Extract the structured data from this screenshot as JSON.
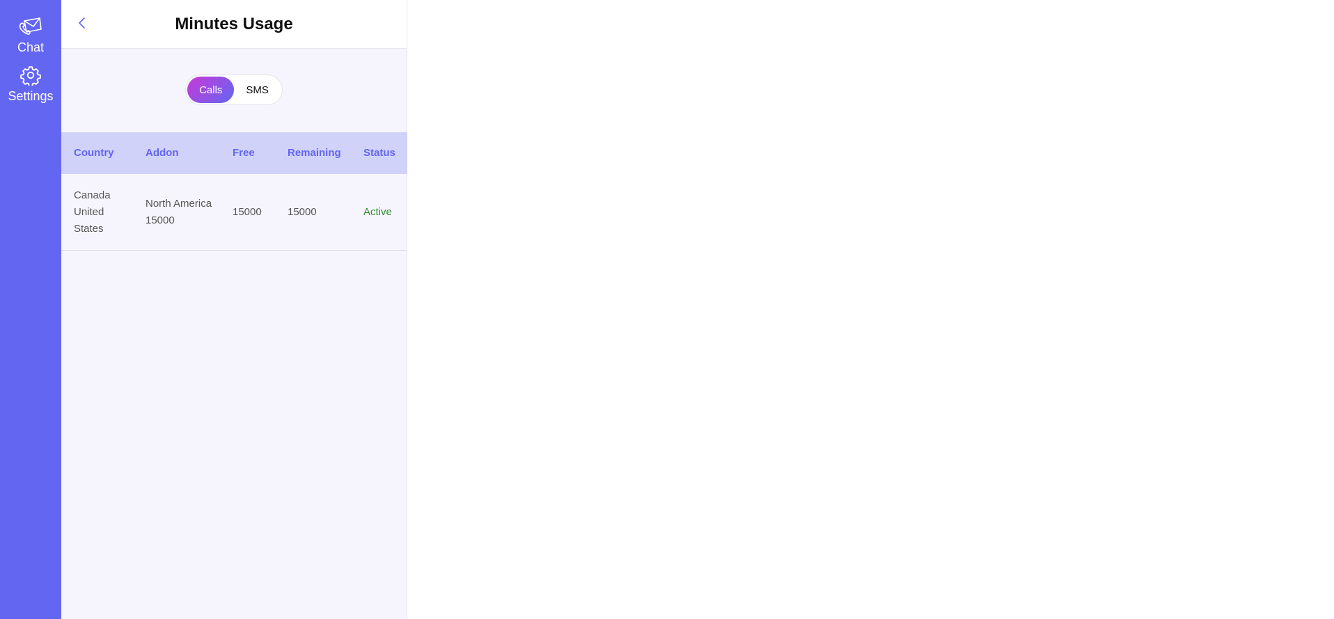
{
  "sidebar": {
    "items": [
      {
        "label": "Chat",
        "icon": "chat-envelope-icon"
      },
      {
        "label": "Settings",
        "icon": "gear-icon"
      }
    ],
    "background": "#6366f1"
  },
  "header": {
    "title": "Minutes Usage",
    "back_icon": "chevron-left-icon"
  },
  "toggle": {
    "options": [
      "Calls",
      "SMS"
    ],
    "selected": "Calls"
  },
  "table": {
    "columns": [
      "Country",
      "Addon",
      "Free",
      "Remaining",
      "Status"
    ],
    "rows": [
      {
        "country": "Canada United States",
        "addon": "North America 15000",
        "free": "15000",
        "remaining": "15000",
        "status": "Active"
      }
    ]
  },
  "colors": {
    "accent": "#6366f1",
    "active_status": "#2e8b2e",
    "header_row": "#d1d2fa"
  }
}
